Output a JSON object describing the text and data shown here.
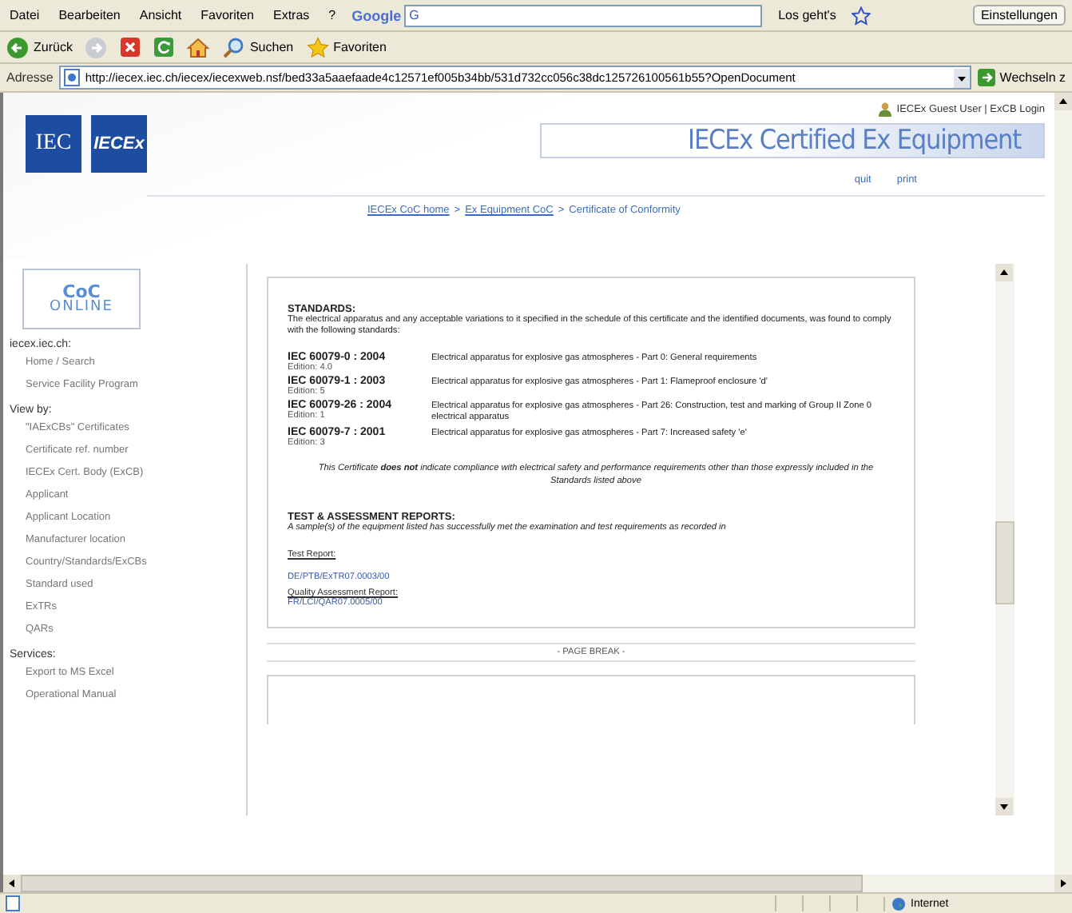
{
  "browser": {
    "menu": [
      "Datei",
      "Bearbeiten",
      "Ansicht",
      "Favoriten",
      "Extras",
      "?"
    ],
    "google": {
      "logo": "Google",
      "letter": "G"
    },
    "go_label": "Los geht's",
    "settings": "Einstellungen",
    "toolbar": [
      {
        "kind": "back",
        "label": "Zurück"
      },
      {
        "kind": "forward"
      },
      {
        "kind": "stop"
      },
      {
        "kind": "refresh"
      },
      {
        "kind": "home"
      },
      {
        "kind": "search",
        "label": "Suchen"
      },
      {
        "kind": "favorites",
        "label": "Favoriten"
      }
    ],
    "address": {
      "label": "Adresse",
      "url": "http://iecex.iec.ch/iecex/iecexweb.nsf/bed33a5aaefaade4c12571ef005b34bb/531d732cc056c38dc125726100561b55?OpenDocument",
      "go": "Wechseln z"
    }
  },
  "site": {
    "logos": [
      "IEC",
      "IECEx"
    ],
    "user": "IECEx Guest User | ExCB Login",
    "title": "IECEx Certified Ex Equipment",
    "actions": [
      "quit",
      "print"
    ],
    "breadcrumb": {
      "items": [
        "IECEx CoC home",
        "Ex Equipment CoC"
      ],
      "separator": ">",
      "current": "Certificate of Conformity"
    }
  },
  "sidebar": {
    "logo": [
      "CoC",
      "ONLINE"
    ],
    "sections": [
      {
        "heading": "iecex.iec.ch:",
        "items": [
          "Home / Search",
          "Service Facility Program"
        ]
      },
      {
        "heading": "View by:",
        "items": [
          "\"IAExCBs\" Certificates",
          "Certificate ref. number",
          "IECEx Cert. Body (ExCB)",
          "Applicant",
          "Applicant Location",
          "Manufacturer location",
          "Country/Standards/ExCBs",
          "Standard used",
          "ExTRs",
          "QARs"
        ]
      },
      {
        "heading": "Services:",
        "items": [
          "Export to MS Excel",
          "Operational Manual"
        ]
      }
    ]
  },
  "certificate": {
    "standards_heading": "STANDARDS:",
    "standards_intro": "The electrical apparatus and any acceptable variations to it specified in the schedule of this certificate and the identified documents, was found to comply with the following standards:",
    "standards": [
      {
        "code": "IEC 60079-0 : 2004",
        "edition": "Edition: 4.0",
        "description": "Electrical apparatus for explosive gas atmospheres - Part 0: General requirements"
      },
      {
        "code": "IEC 60079-1 : 2003",
        "edition": "Edition: 5",
        "description": "Electrical apparatus for explosive gas atmospheres - Part 1: Flameproof enclosure 'd'"
      },
      {
        "code": "IEC 60079-26 : 2004",
        "edition": "Edition: 1",
        "description": "Electrical apparatus for explosive gas atmospheres - Part 26: Construction, test and marking of Group II Zone 0 electrical apparatus"
      },
      {
        "code": "IEC 60079-7 : 2001",
        "edition": "Edition: 3",
        "description": "Electrical apparatus for explosive gas atmospheres - Part 7: Increased safety 'e'"
      }
    ],
    "disclaimer": "This Certificate **does not** indicate compliance with electrical safety and performance requirements other than those expressly included in the Standards listed above",
    "reports_heading": "TEST & ASSESSMENT REPORTS:",
    "reports_intro": "A sample(s) of the equipment listed has successfully met the examination and test requirements as recorded in",
    "reports": [
      {
        "label": "Test Report:",
        "value": "DE/PTB/ExTR07.0003/00"
      },
      {
        "label": "Quality Assessment Report:",
        "value": "FR/LCI/QAR07.0005/00"
      }
    ],
    "page_break": "- PAGE BREAK -"
  },
  "status_bar": {
    "zone": "Internet"
  }
}
